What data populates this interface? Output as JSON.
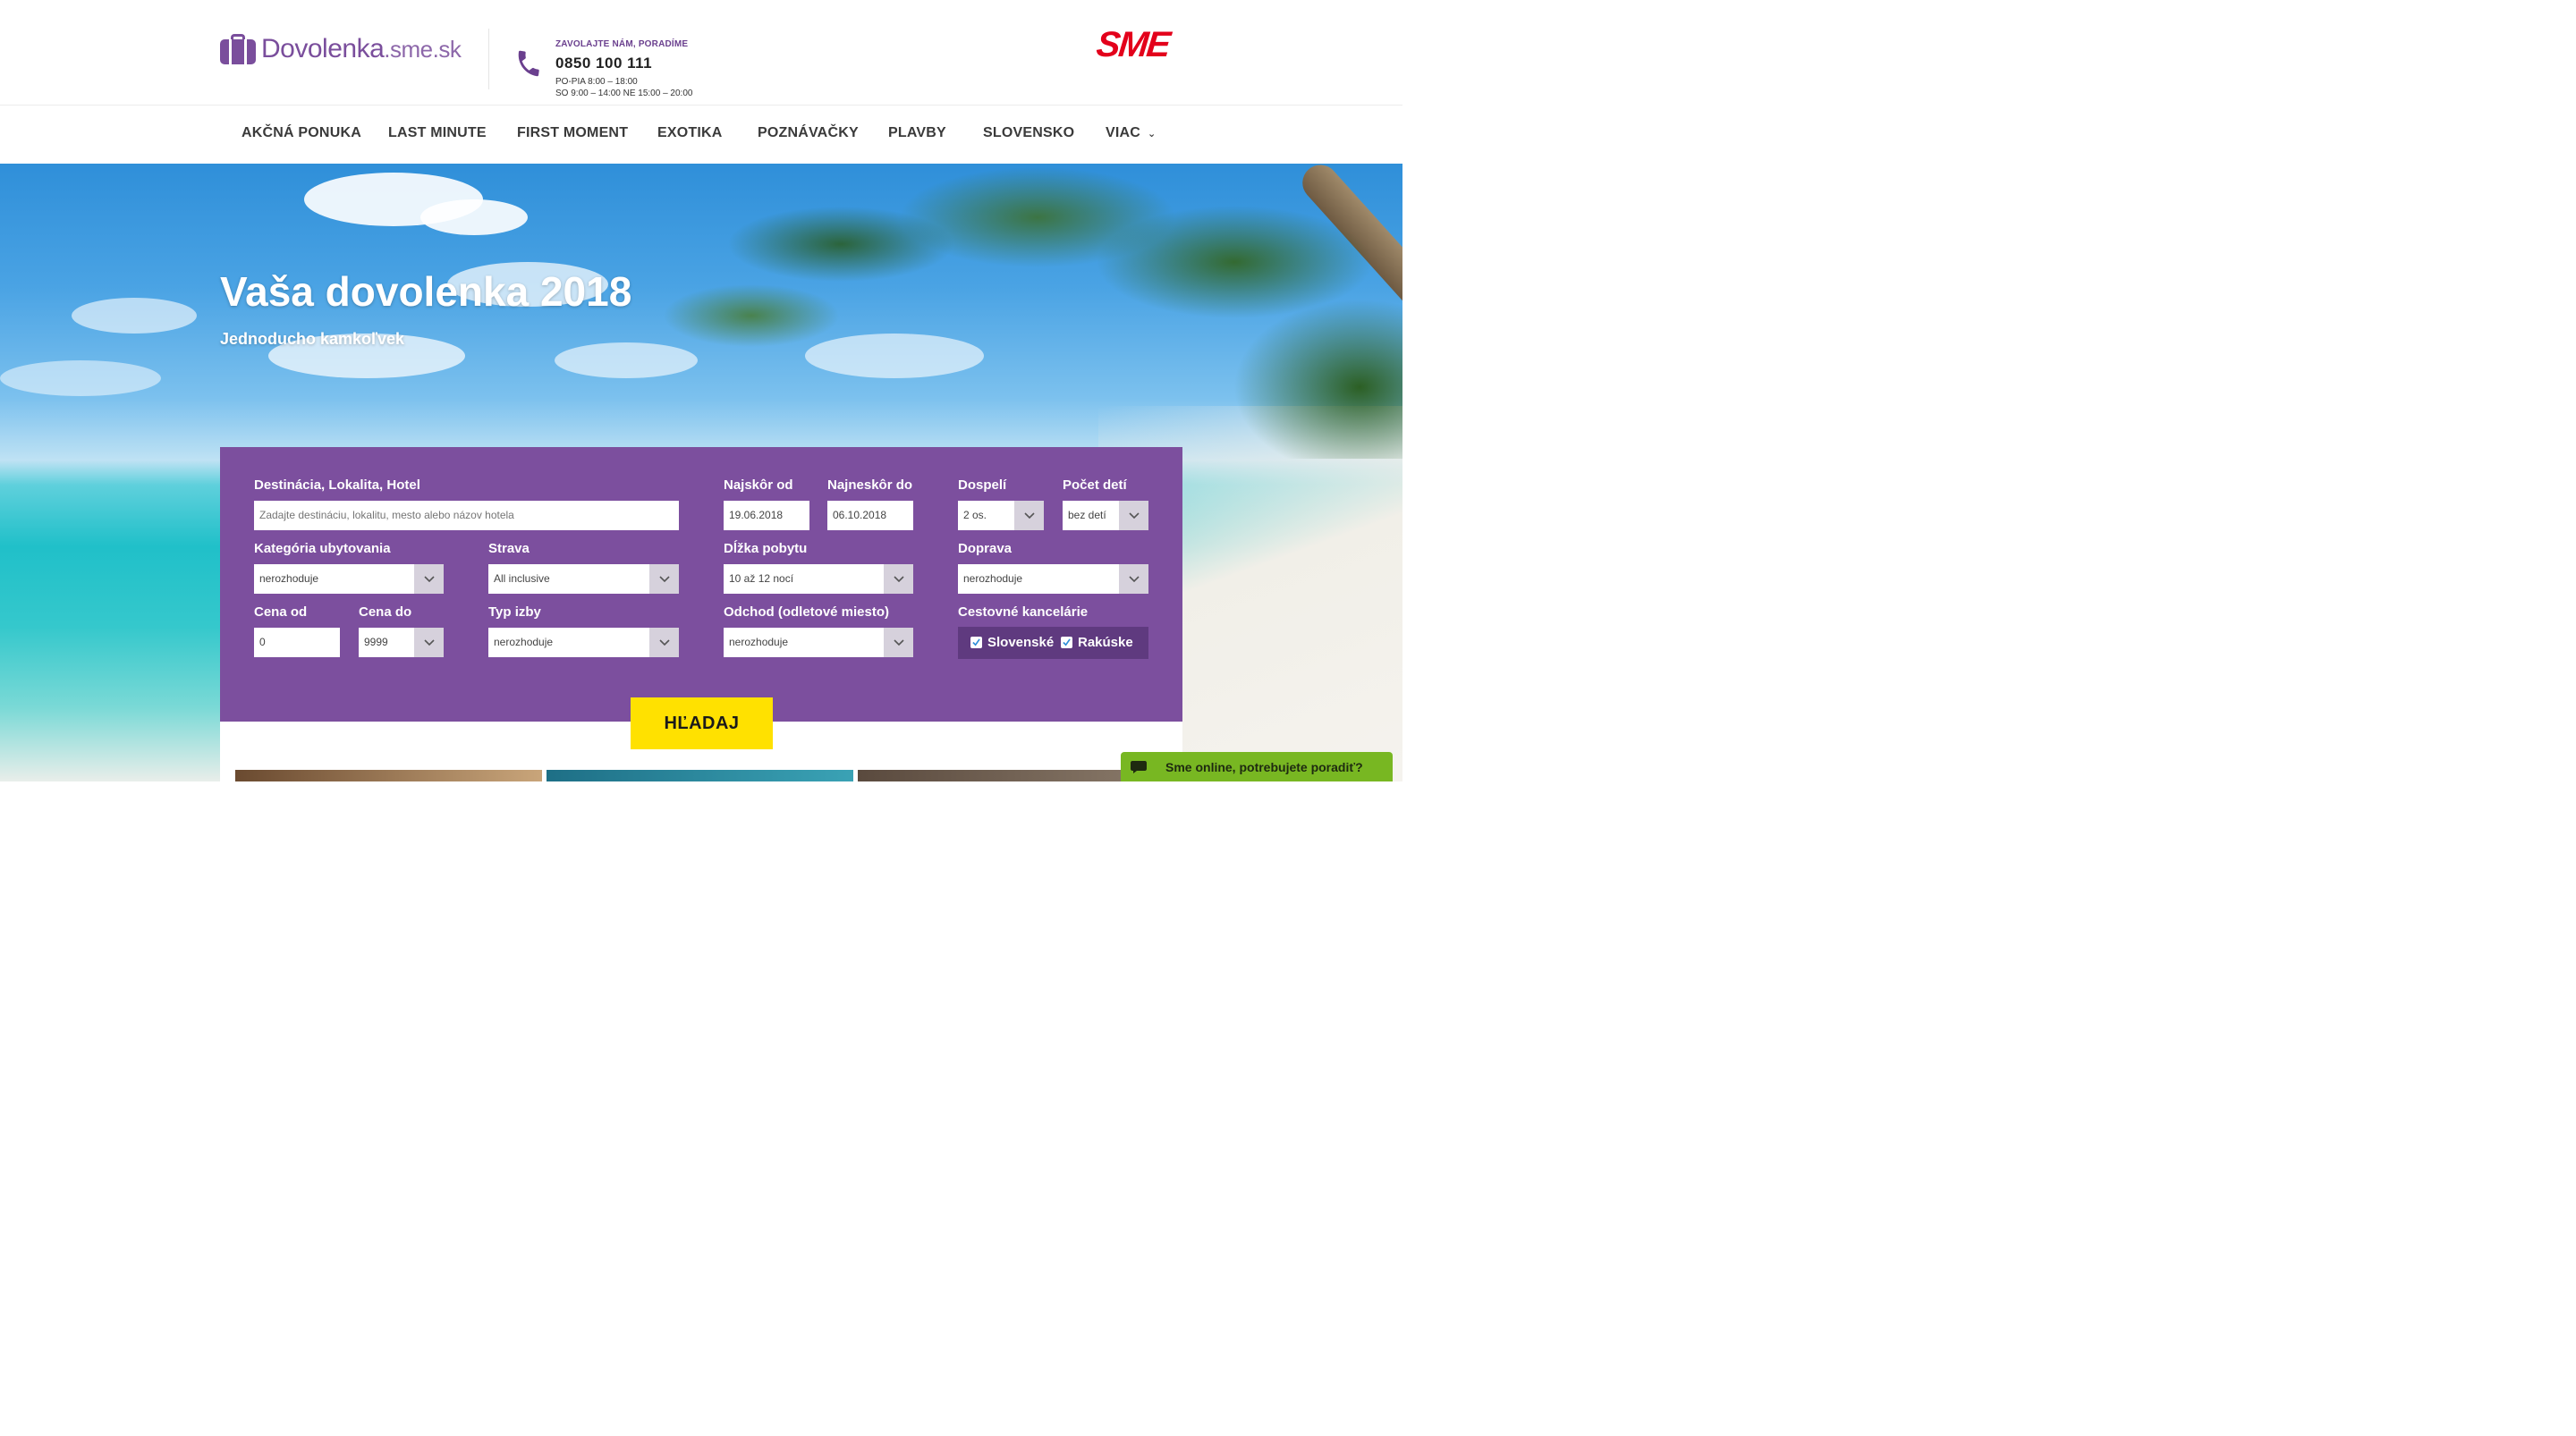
{
  "header": {
    "logo_main": "Dovolenka",
    "logo_suffix": ".sme.sk",
    "contact_label": "ZAVOLAJTE NÁM, PORADÍME",
    "phone": "0850 100 111",
    "hours_line1": "PO-PIA 8:00 – 18:00",
    "hours_line2": "SO 9:00 – 14:00 NE 15:00 – 20:00",
    "partner_logo": "SME"
  },
  "nav": {
    "items": [
      "AKČNÁ PONUKA",
      "LAST MINUTE",
      "FIRST MOMENT",
      "EXOTIKA",
      "POZNÁVAČKY",
      "PLAVBY",
      "SLOVENSKO",
      "VIAC"
    ]
  },
  "hero": {
    "title": "Vaša dovolenka 2018",
    "subtitle": "Jednoducho kamkoľvek"
  },
  "search": {
    "destination_label": "Destinácia, Lokalita, Hotel",
    "destination_placeholder": "Zadajte destináciu, lokalitu, mesto alebo názov hotela",
    "from_label": "Najskôr od",
    "from_value": "19.06.2018",
    "to_label": "Najneskôr do",
    "to_value": "06.10.2018",
    "adults_label": "Dospelí",
    "adults_value": "2 os.",
    "kids_label": "Počet detí",
    "kids_value": "bez detí",
    "category_label": "Kategória ubytovania",
    "category_value": "nerozhoduje",
    "board_label": "Strava",
    "board_value": "All inclusive",
    "length_label": "Dĺžka pobytu",
    "length_value": "10 až 12 nocí",
    "transport_label": "Doprava",
    "transport_value": "nerozhoduje",
    "price_from_label": "Cena od",
    "price_from_value": "0",
    "price_to_label": "Cena do",
    "price_to_value": "9999",
    "room_label": "Typ izby",
    "room_value": "nerozhoduje",
    "departure_label": "Odchod (odletové miesto)",
    "departure_value": "nerozhoduje",
    "agencies_label": "Cestovné kancelárie",
    "agency_sk": "Slovenské",
    "agency_at": "Rakúske",
    "button": "HĽADAJ"
  },
  "chat": {
    "text": "Sme online, potrebujete poradiť?"
  },
  "colors": {
    "brand_purple": "#7c4f9e",
    "button_yellow": "#ffe100",
    "chat_green": "#78b722",
    "sme_red": "#e3001b"
  }
}
